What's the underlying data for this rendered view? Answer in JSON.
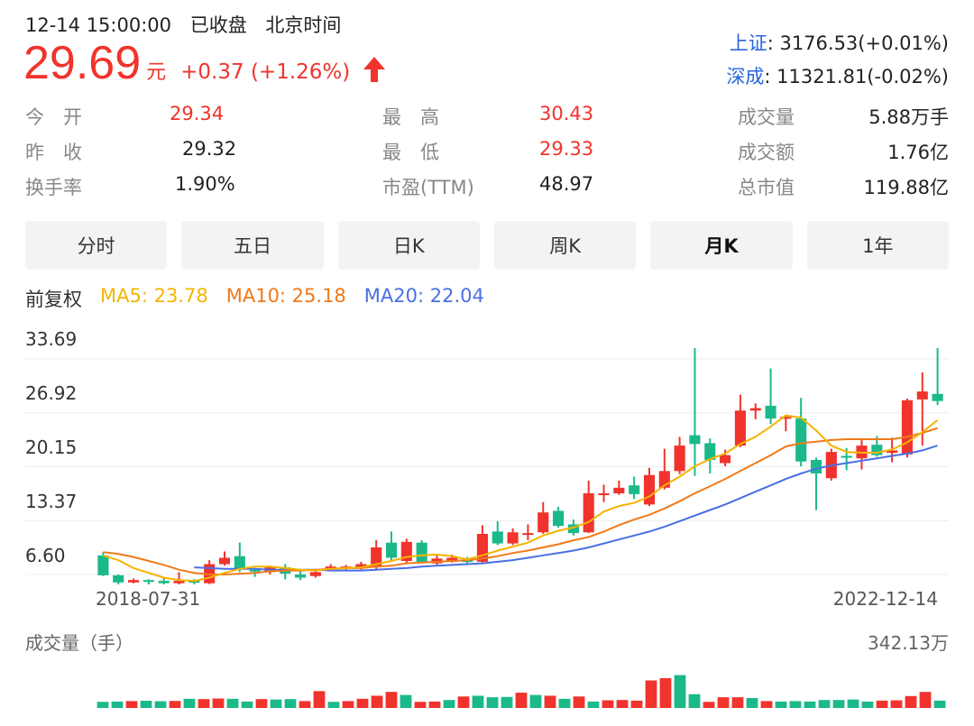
{
  "header": {
    "datetime": "12-14 15:00:00",
    "status": "已收盘",
    "timezone": "北京时间",
    "price": "29.69",
    "currency": "元",
    "change": "+0.37 (+1.26%)",
    "direction_icon": "up-arrow-icon"
  },
  "indices": [
    {
      "label": "上证",
      "value": ": 3176.53(+0.01%)"
    },
    {
      "label": "深成",
      "value": ": 11321.81(-0.02%)"
    }
  ],
  "stats": {
    "open_label": "今　开",
    "open": "29.34",
    "prev_close_label": "昨　收",
    "prev_close": "29.32",
    "turnover_label": "换手率",
    "turnover": "1.90%",
    "high_label": "最　高",
    "high": "30.43",
    "low_label": "最　低",
    "low": "29.33",
    "pe_label": "市盈(TTM)",
    "pe": "48.97",
    "volume_label": "成交量",
    "volume": "5.88万手",
    "amount_label": "成交额",
    "amount": "1.76亿",
    "mktcap_label": "总市值",
    "mktcap": "119.88亿"
  },
  "tabs": [
    {
      "label": "分时",
      "active": false
    },
    {
      "label": "五日",
      "active": false
    },
    {
      "label": "日K",
      "active": false
    },
    {
      "label": "周K",
      "active": false
    },
    {
      "label": "月K",
      "active": true
    },
    {
      "label": "1年",
      "active": false
    }
  ],
  "legend": {
    "adjust": "前复权",
    "ma5": "MA5: 23.78",
    "ma10": "MA10: 25.18",
    "ma20": "MA20: 22.04"
  },
  "colors": {
    "up": "#f0332c",
    "down": "#1bb98a",
    "ma5": "#f4b400",
    "ma10": "#f07a1a",
    "ma20": "#4a6fe3",
    "index_label": "#2867d9"
  },
  "chart_data": {
    "type": "candlestick",
    "y_ticks": [
      "33.69",
      "26.92",
      "20.15",
      "13.37",
      "6.60"
    ],
    "ylim": [
      6.6,
      33.69
    ],
    "x_start_label": "2018-07-31",
    "x_end_label": "2022-12-14",
    "candles": [
      {
        "o": 9.0,
        "c": 6.5,
        "h": 9.4,
        "l": 6.4
      },
      {
        "o": 6.5,
        "c": 5.6,
        "h": 6.6,
        "l": 5.3
      },
      {
        "o": 5.6,
        "c": 5.9,
        "h": 6.1,
        "l": 5.5
      },
      {
        "o": 5.9,
        "c": 5.8,
        "h": 6.0,
        "l": 4.9
      },
      {
        "o": 5.8,
        "c": 5.5,
        "h": 6.2,
        "l": 5.1
      },
      {
        "o": 5.5,
        "c": 5.8,
        "h": 6.9,
        "l": 5.1
      },
      {
        "o": 5.8,
        "c": 5.7,
        "h": 6.0,
        "l": 5.3
      },
      {
        "o": 5.5,
        "c": 7.9,
        "h": 8.4,
        "l": 5.4
      },
      {
        "o": 7.9,
        "c": 8.7,
        "h": 9.5,
        "l": 7.7
      },
      {
        "o": 8.9,
        "c": 7.3,
        "h": 10.6,
        "l": 6.9
      },
      {
        "o": 7.2,
        "c": 7.0,
        "h": 7.3,
        "l": 6.3
      },
      {
        "o": 6.9,
        "c": 7.5,
        "h": 7.7,
        "l": 6.6
      },
      {
        "o": 7.5,
        "c": 6.7,
        "h": 7.9,
        "l": 6.0
      },
      {
        "o": 6.6,
        "c": 6.2,
        "h": 7.1,
        "l": 5.9
      },
      {
        "o": 6.4,
        "c": 6.9,
        "h": 7.2,
        "l": 6.2
      },
      {
        "o": 7.5,
        "c": 7.6,
        "h": 7.9,
        "l": 7.2
      },
      {
        "o": 7.4,
        "c": 7.6,
        "h": 7.8,
        "l": 7.2
      },
      {
        "o": 7.5,
        "c": 7.9,
        "h": 8.2,
        "l": 7.2
      },
      {
        "o": 7.5,
        "c": 10.0,
        "h": 10.9,
        "l": 7.3
      },
      {
        "o": 10.6,
        "c": 8.7,
        "h": 12.0,
        "l": 8.4
      },
      {
        "o": 8.3,
        "c": 10.7,
        "h": 11.1,
        "l": 8.1
      },
      {
        "o": 10.6,
        "c": 8.2,
        "h": 10.9,
        "l": 8.0
      },
      {
        "o": 8.0,
        "c": 8.6,
        "h": 9.1,
        "l": 7.8
      },
      {
        "o": 8.2,
        "c": 8.7,
        "h": 9.1,
        "l": 8.1
      },
      {
        "o": 8.4,
        "c": 8.2,
        "h": 8.8,
        "l": 7.9
      },
      {
        "o": 8.2,
        "c": 11.7,
        "h": 12.8,
        "l": 8.1
      },
      {
        "o": 12.0,
        "c": 10.5,
        "h": 13.3,
        "l": 10.3
      },
      {
        "o": 10.5,
        "c": 11.9,
        "h": 12.4,
        "l": 10.3
      },
      {
        "o": 11.8,
        "c": 11.8,
        "h": 12.9,
        "l": 10.9
      },
      {
        "o": 11.9,
        "c": 14.4,
        "h": 15.7,
        "l": 11.7
      },
      {
        "o": 14.6,
        "c": 12.7,
        "h": 15.1,
        "l": 12.5
      },
      {
        "o": 12.9,
        "c": 11.8,
        "h": 13.5,
        "l": 11.5
      },
      {
        "o": 11.9,
        "c": 16.8,
        "h": 18.4,
        "l": 11.8
      },
      {
        "o": 16.8,
        "c": 16.8,
        "h": 17.9,
        "l": 15.7
      },
      {
        "o": 16.8,
        "c": 17.5,
        "h": 18.4,
        "l": 16.6
      },
      {
        "o": 17.8,
        "c": 16.7,
        "h": 18.9,
        "l": 16.1
      },
      {
        "o": 15.4,
        "c": 19.1,
        "h": 20.0,
        "l": 15.2
      },
      {
        "o": 17.5,
        "c": 19.6,
        "h": 22.4,
        "l": 17.3
      },
      {
        "o": 19.6,
        "c": 22.8,
        "h": 23.9,
        "l": 19.2
      },
      {
        "o": 24.1,
        "c": 23.0,
        "h": 36.0,
        "l": 19.0
      },
      {
        "o": 23.1,
        "c": 21.0,
        "h": 23.7,
        "l": 19.3
      },
      {
        "o": 20.6,
        "c": 21.6,
        "h": 22.3,
        "l": 20.2
      },
      {
        "o": 22.8,
        "c": 27.2,
        "h": 29.2,
        "l": 22.6
      },
      {
        "o": 27.2,
        "c": 27.5,
        "h": 28.1,
        "l": 26.1
      },
      {
        "o": 27.8,
        "c": 26.2,
        "h": 32.5,
        "l": 25.5
      },
      {
        "o": 26.3,
        "c": 26.4,
        "h": 26.6,
        "l": 24.6
      },
      {
        "o": 26.2,
        "c": 20.8,
        "h": 28.8,
        "l": 20.2
      },
      {
        "o": 21.0,
        "c": 19.3,
        "h": 21.3,
        "l": 14.7
      },
      {
        "o": 18.7,
        "c": 22.0,
        "h": 22.4,
        "l": 18.4
      },
      {
        "o": 21.5,
        "c": 21.4,
        "h": 22.5,
        "l": 19.7
      },
      {
        "o": 21.2,
        "c": 22.8,
        "h": 23.6,
        "l": 19.8
      },
      {
        "o": 22.9,
        "c": 21.6,
        "h": 24.0,
        "l": 21.4
      },
      {
        "o": 21.9,
        "c": 22.2,
        "h": 23.8,
        "l": 20.7
      },
      {
        "o": 21.7,
        "c": 28.5,
        "h": 28.7,
        "l": 21.3
      },
      {
        "o": 28.6,
        "c": 29.6,
        "h": 32.0,
        "l": 22.8
      },
      {
        "o": 29.3,
        "c": 28.4,
        "h": 36.0,
        "l": 27.9
      }
    ],
    "ma5": [
      9.0,
      8.4,
      7.4,
      6.8,
      6.2,
      5.9,
      5.8,
      6.2,
      6.8,
      7.3,
      7.6,
      7.6,
      7.4,
      7.2,
      7.1,
      7.3,
      7.4,
      7.5,
      7.9,
      8.3,
      8.8,
      9.0,
      9.1,
      8.9,
      8.5,
      9.0,
      9.6,
      10.1,
      10.6,
      11.5,
      12.1,
      12.5,
      13.2,
      14.5,
      15.2,
      15.6,
      16.4,
      17.8,
      18.9,
      20.2,
      21.1,
      21.8,
      23.0,
      23.9,
      25.2,
      26.6,
      26.3,
      24.7,
      22.8,
      22.0,
      21.9,
      21.9,
      22.3,
      23.2,
      24.5,
      26.0
    ],
    "ma10": [
      9.4,
      9.2,
      8.8,
      8.3,
      7.8,
      7.2,
      6.8,
      6.6,
      6.6,
      6.7,
      6.8,
      7.0,
      7.1,
      7.1,
      7.2,
      7.3,
      7.4,
      7.4,
      7.6,
      7.7,
      8.0,
      8.1,
      8.2,
      8.3,
      8.4,
      8.6,
      8.9,
      9.3,
      9.6,
      10.0,
      10.4,
      10.9,
      11.3,
      12.0,
      12.8,
      13.5,
      14.1,
      14.9,
      15.8,
      16.8,
      17.7,
      18.6,
      19.6,
      20.6,
      21.6,
      22.7,
      23.1,
      23.3,
      23.5,
      23.6,
      23.6,
      23.6,
      23.6,
      23.9,
      24.4,
      25.0
    ],
    "ma20": [
      null,
      null,
      null,
      null,
      null,
      null,
      7.5,
      7.4,
      7.3,
      7.3,
      7.3,
      7.2,
      7.2,
      7.2,
      7.2,
      7.1,
      7.1,
      7.1,
      7.2,
      7.3,
      7.4,
      7.6,
      7.7,
      7.8,
      7.9,
      8.0,
      8.2,
      8.4,
      8.7,
      9.0,
      9.3,
      9.6,
      10.0,
      10.5,
      11.0,
      11.5,
      12.0,
      12.6,
      13.3,
      14.0,
      14.7,
      15.4,
      16.2,
      17.0,
      17.8,
      18.6,
      19.3,
      19.9,
      20.3,
      20.6,
      20.9,
      21.2,
      21.5,
      21.8,
      22.2,
      22.8
    ]
  },
  "volume": {
    "title": "成交量（手）",
    "max_label": "342.13万",
    "max": 342.13,
    "bars": [
      {
        "v": 40,
        "up": false
      },
      {
        "v": 42,
        "up": false
      },
      {
        "v": 45,
        "up": true
      },
      {
        "v": 47,
        "up": false
      },
      {
        "v": 44,
        "up": false
      },
      {
        "v": 46,
        "up": true
      },
      {
        "v": 60,
        "up": false
      },
      {
        "v": 58,
        "up": true
      },
      {
        "v": 62,
        "up": true
      },
      {
        "v": 60,
        "up": false
      },
      {
        "v": 42,
        "up": false
      },
      {
        "v": 58,
        "up": true
      },
      {
        "v": 55,
        "up": false
      },
      {
        "v": 58,
        "up": false
      },
      {
        "v": 45,
        "up": true
      },
      {
        "v": 110,
        "up": true
      },
      {
        "v": 40,
        "up": false
      },
      {
        "v": 45,
        "up": true
      },
      {
        "v": 60,
        "up": true
      },
      {
        "v": 80,
        "up": true
      },
      {
        "v": 105,
        "up": true
      },
      {
        "v": 85,
        "up": false
      },
      {
        "v": 40,
        "up": true
      },
      {
        "v": 42,
        "up": true
      },
      {
        "v": 52,
        "up": false
      },
      {
        "v": 75,
        "up": true
      },
      {
        "v": 80,
        "up": false
      },
      {
        "v": 70,
        "up": false
      },
      {
        "v": 72,
        "up": false
      },
      {
        "v": 100,
        "up": true
      },
      {
        "v": 85,
        "up": false
      },
      {
        "v": 80,
        "up": true
      },
      {
        "v": 60,
        "up": false
      },
      {
        "v": 75,
        "up": true
      },
      {
        "v": 42,
        "up": false
      },
      {
        "v": 50,
        "up": true
      },
      {
        "v": 52,
        "up": true
      },
      {
        "v": 48,
        "up": true
      },
      {
        "v": 180,
        "up": true
      },
      {
        "v": 195,
        "up": true
      },
      {
        "v": 215,
        "up": false
      },
      {
        "v": 90,
        "up": false
      },
      {
        "v": 40,
        "up": true
      },
      {
        "v": 70,
        "up": true
      },
      {
        "v": 70,
        "up": true
      },
      {
        "v": 65,
        "up": false
      },
      {
        "v": 45,
        "up": true
      },
      {
        "v": 42,
        "up": false
      },
      {
        "v": 45,
        "up": false
      },
      {
        "v": 42,
        "up": false
      },
      {
        "v": 52,
        "up": false
      },
      {
        "v": 52,
        "up": false
      },
      {
        "v": 55,
        "up": false
      },
      {
        "v": 42,
        "up": false
      },
      {
        "v": 48,
        "up": true
      },
      {
        "v": 50,
        "up": true
      },
      {
        "v": 78,
        "up": true
      },
      {
        "v": 105,
        "up": true
      },
      {
        "v": 48,
        "up": false
      }
    ]
  }
}
